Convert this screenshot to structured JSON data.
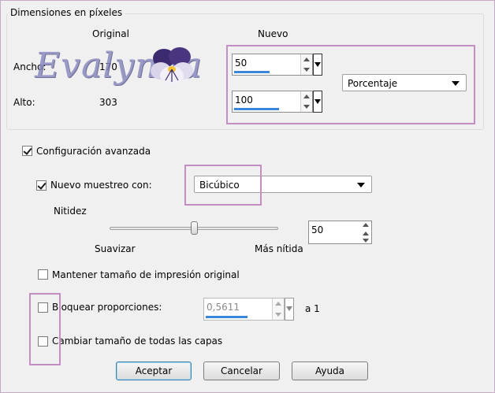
{
  "pixel_group": {
    "title": "Dimensiones en píxeles",
    "col_original": "Original",
    "col_new": "Nuevo",
    "width_label": "Ancho:",
    "width_original": "170",
    "height_label": "Alto:",
    "height_original": "303",
    "width_new": "50",
    "height_new": "100",
    "width_new_fill": 0.5,
    "height_new_fill": 0.6,
    "unit_select": "Porcentaje"
  },
  "watermark": {
    "text": "Evalynda"
  },
  "advanced": {
    "label": "Configuración avanzada",
    "checked": true,
    "resample_label": "Nuevo muestreo con:",
    "resample_checked": true,
    "resample_method": "Bicúbico",
    "sharpness_label": "Nitidez",
    "smooth_label": "Suavizar",
    "sharper_label": "Más nítida",
    "sharpness_value": "50",
    "sharpness_level": 0.5
  },
  "options": {
    "keep_print_size": "Mantener tamaño de impresión original",
    "lock_ratio": "Bloquear proporciones:",
    "ratio_value": "0,5611",
    "ratio_suffix": "a 1",
    "resize_all_layers": "Cambiar tamaño de todas las capas"
  },
  "buttons": {
    "accept": "Aceptar",
    "cancel": "Cancelar",
    "help": "Ayuda"
  },
  "colors": {
    "highlight": "#c48ec4",
    "accent": "#3a86d8"
  }
}
